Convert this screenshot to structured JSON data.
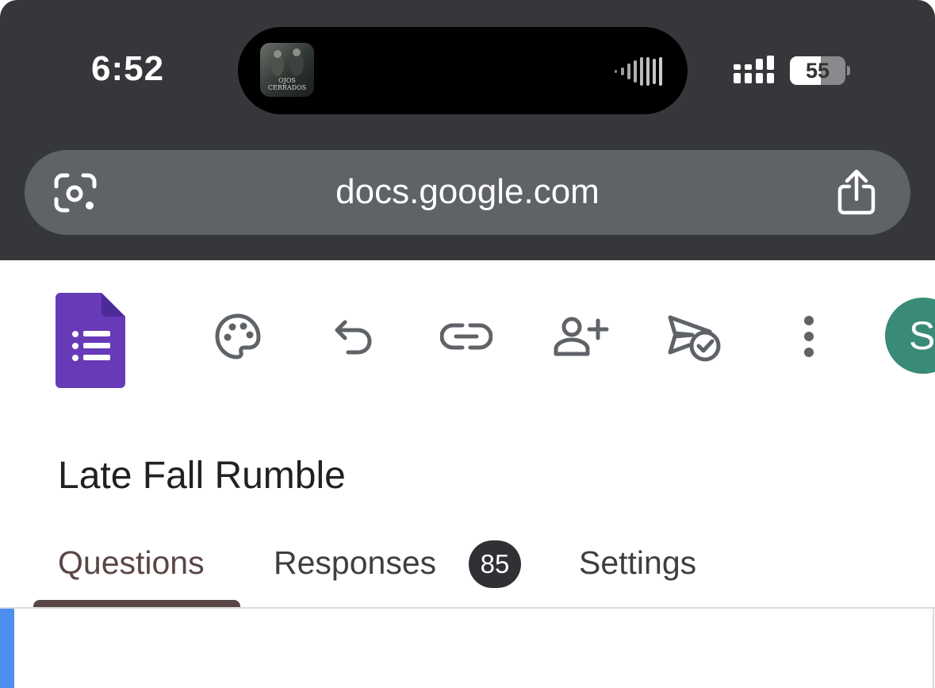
{
  "status": {
    "time": "6:52",
    "battery_percent": "55",
    "battery_level": 0.55,
    "now_playing_art_text": "OJOS CERRADOS"
  },
  "browser": {
    "url": "docs.google.com"
  },
  "toolbar": {
    "icons": [
      "google-forms-logo",
      "palette-icon",
      "undo-icon",
      "link-icon",
      "add-collaborator-icon",
      "send-check-icon",
      "more-vert-icon"
    ],
    "avatar_letter": "S",
    "colors": {
      "forms_purple": "#673ab7",
      "avatar": "#3a8a78"
    }
  },
  "form": {
    "title": "Late Fall Rumble"
  },
  "tabs": {
    "questions": "Questions",
    "responses": "Responses",
    "responses_count": "85",
    "settings": "Settings"
  },
  "accent": "#4f8ef1"
}
